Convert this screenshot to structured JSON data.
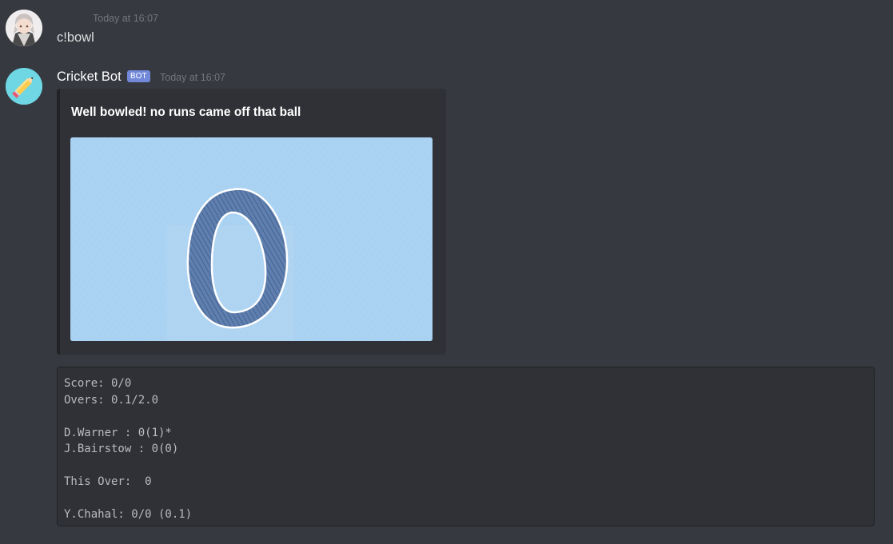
{
  "messages": {
    "user": {
      "avatar_icon": "anime-character-avatar",
      "timestamp": "Today at 16:07",
      "text": "c!bowl"
    },
    "bot": {
      "avatar_icon": "pencil-icon",
      "name": "Cricket Bot",
      "tag": "BOT",
      "timestamp": "Today at 16:07",
      "embed": {
        "title": "Well bowled! no runs came off that ball",
        "image_icon": "hand-drawn-zero-illustration"
      },
      "scorecard": {
        "lines": [
          "Score: 0/0",
          "Overs: 0.1/2.0",
          "",
          "D.Warner : 0(1)*",
          "J.Bairstow : 0(0)",
          "",
          "This Over:  0",
          "",
          "Y.Chahal: 0/0 (0.1)"
        ]
      }
    }
  },
  "colors": {
    "background": "#36393f",
    "embed_background": "#2f3136",
    "bot_tag": "#7289da",
    "timestamp": "#72767d",
    "image_sky": "#a9d1f1",
    "zero_stroke": "#4f6e9e"
  }
}
